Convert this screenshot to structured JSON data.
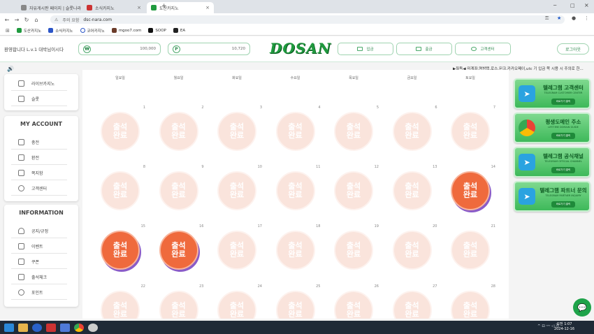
{
  "browser": {
    "tabs": [
      {
        "label": "자유게시판 페이지 | 슬롯나라"
      },
      {
        "label": "소식카지노"
      },
      {
        "label": "도산카지노"
      }
    ],
    "new_tab": "+",
    "address_chip": "주의 요함",
    "url": "dsc-nara.com",
    "bookmarks": [
      "도산카지노",
      "소식카지노",
      "코어카지노",
      "mgoo7.com",
      "SOOP",
      "EA"
    ]
  },
  "header": {
    "welcome": "환영합니다 L.v.1 대박님이시다",
    "won_balance": "100,000",
    "point_balance": "10,720",
    "won_icon": "₩",
    "point_icon": "P",
    "logo": "DOSAN",
    "deposit": "입금",
    "withdraw": "출금",
    "support": "고객센터",
    "logout": "로그아웃"
  },
  "notice": {
    "text": "▶필독◀ 미계좌,명방탭,로스,된크,카카오페이,utc 기 입금 쪽 시용 시 주의로 한..."
  },
  "sidebar": {
    "top_items": [
      "라이브카지노",
      "슬롯"
    ],
    "account_title": "MY ACCOUNT",
    "account_items": [
      "충전",
      "환전",
      "쪽지함",
      "고객센터"
    ],
    "info_title": "INFORMATION",
    "info_items": [
      "공지/규정",
      "이벤트",
      "쿠폰",
      "출석체크",
      "포인트"
    ]
  },
  "calendar": {
    "weekdays": [
      "일요일",
      "월요일",
      "화요일",
      "수요일",
      "목요일",
      "금요일",
      "토요일"
    ],
    "stamp_text_1": "출석",
    "stamp_text_2": "완료",
    "days": [
      "1",
      "2",
      "3",
      "4",
      "5",
      "6",
      "7",
      "8",
      "9",
      "10",
      "11",
      "12",
      "13",
      "14",
      "15",
      "16",
      "17",
      "18",
      "19",
      "20",
      "21",
      "22",
      "23",
      "24",
      "25",
      "26",
      "27",
      "28"
    ],
    "attended_days": [
      14,
      15,
      16
    ]
  },
  "right_banners": [
    {
      "title": "텔레그램 고객센터",
      "sub": "TELEGRAM CUSTOMER CENTER",
      "btn": "바로가기 클릭"
    },
    {
      "title": "평생도메인 주소",
      "sub": "LIFETIME DOMAIN GUIDE",
      "btn": "바로가기 클릭"
    },
    {
      "title": "텔레그램 공식채널",
      "sub": "TELEGRAM OFFICIAL CHANNEL",
      "btn": "바로가기 클릭"
    },
    {
      "title": "텔레그램 파트너 문의",
      "sub": "TELEGRAM PARTNER INQUIRY",
      "btn": "바로가기 클릭"
    }
  ],
  "taskbar": {
    "time": "오전 1:07",
    "date": "2024-12-16",
    "tray": "^ ⊡ 〰 ◁ 가"
  },
  "colors": {
    "brand": "#1f9a3e",
    "stamp_active": "#ef6a3d",
    "stamp_faded": "#f09f86"
  }
}
